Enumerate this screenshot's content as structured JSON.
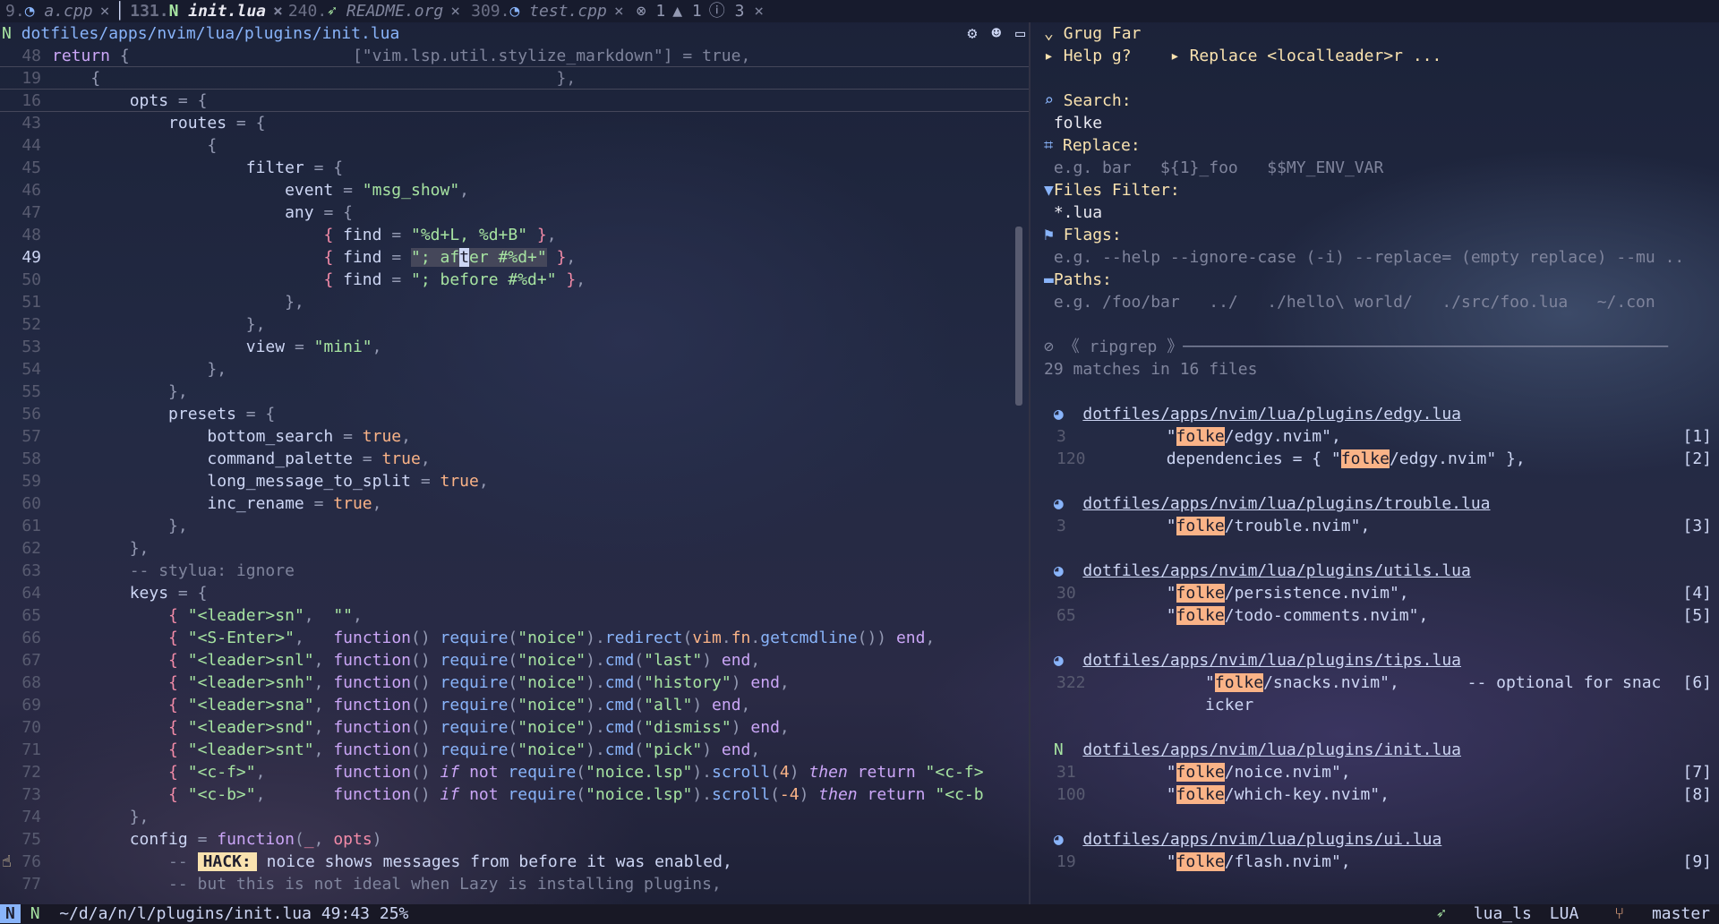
{
  "tabs": [
    {
      "num": "9.",
      "name": "a.cpp",
      "icon": "c-icon",
      "active": false
    },
    {
      "num": "131.",
      "name": "init.lua",
      "icon": "neovim-icon",
      "active": true
    },
    {
      "num": "240.",
      "name": "README.org",
      "icon": "org-icon",
      "active": false
    },
    {
      "num": "309.",
      "name": "test.cpp",
      "icon": "c-icon",
      "active": false
    }
  ],
  "diagnostics": {
    "errors": "1",
    "warnings": "1",
    "info": "3"
  },
  "winbar": {
    "path": "dotfiles/apps/nvim/lua/plugins/init.lua"
  },
  "code": {
    "context": [
      {
        "ln": "48",
        "t": "return {"
      },
      {
        "ln": "19",
        "t": "  {"
      },
      {
        "ln": "16",
        "t": "    opts = {"
      }
    ]
  },
  "grug": {
    "title": "Grug Far",
    "help": "Help g?",
    "replace_hint": "Replace <localleader>r ...",
    "search_label": "Search:",
    "search_value": "folke",
    "replace_label": "Replace:",
    "replace_placeholder": "e.g. bar   ${1}_foo   $$MY_ENV_VAR",
    "files_label": "Files Filter:",
    "files_value": "*.lua",
    "flags_label": "Flags:",
    "flags_placeholder": "e.g. --help --ignore-case (-i) --replace= (empty replace) --mu ..",
    "paths_label": "Paths:",
    "paths_placeholder": "e.g. /foo/bar   ../   ./hello\\ world/   ./src/foo.lua   ~/.con",
    "engine": "《 ripgrep 》",
    "summary": "29 matches in 16 files",
    "results": [
      {
        "file": "dotfiles/apps/nvim/lua/plugins/edgy.lua",
        "lines": [
          {
            "ln": "3",
            "pre": "        \"",
            "m": "folke",
            "post": "/edgy.nvim\",",
            "ref": "[1]"
          },
          {
            "ln": "120",
            "pre": "        dependencies = { \"",
            "m": "folke",
            "post": "/edgy.nvim\" },",
            "ref": "[2]"
          }
        ]
      },
      {
        "file": "dotfiles/apps/nvim/lua/plugins/trouble.lua",
        "lines": [
          {
            "ln": "3",
            "pre": "        \"",
            "m": "folke",
            "post": "/trouble.nvim\",",
            "ref": "[3]"
          }
        ]
      },
      {
        "file": "dotfiles/apps/nvim/lua/plugins/utils.lua",
        "lines": [
          {
            "ln": "30",
            "pre": "        \"",
            "m": "folke",
            "post": "/persistence.nvim\",",
            "ref": "[4]"
          },
          {
            "ln": "65",
            "pre": "        \"",
            "m": "folke",
            "post": "/todo-comments.nvim\",",
            "ref": "[5]"
          }
        ]
      },
      {
        "file": "dotfiles/apps/nvim/lua/plugins/tips.lua",
        "lines": [
          {
            "ln": "322",
            "pre": "            \"",
            "m": "folke",
            "post": "/snacks.nvim\",       -- optional for snac",
            "ref": "[6]"
          },
          {
            "ln": "",
            "pre": "            icker",
            "m": "",
            "post": "",
            "ref": ""
          }
        ]
      },
      {
        "file": "dotfiles/apps/nvim/lua/plugins/init.lua",
        "lines": [
          {
            "ln": "31",
            "pre": "        \"",
            "m": "folke",
            "post": "/noice.nvim\",",
            "ref": "[7]"
          },
          {
            "ln": "100",
            "pre": "        \"",
            "m": "folke",
            "post": "/which-key.nvim\",",
            "ref": "[8]"
          }
        ]
      },
      {
        "file": "dotfiles/apps/nvim/lua/plugins/ui.lua",
        "lines": [
          {
            "ln": "19",
            "pre": "        \"",
            "m": "folke",
            "post": "/flash.nvim\",",
            "ref": "[9]"
          }
        ]
      }
    ]
  },
  "status": {
    "mode": "N",
    "file": "~/d/a/n/l/plugins/init.lua",
    "pos": "49:43",
    "pct": "25%",
    "lsp": "lua_ls",
    "ft": "LUA",
    "branch": "master"
  }
}
